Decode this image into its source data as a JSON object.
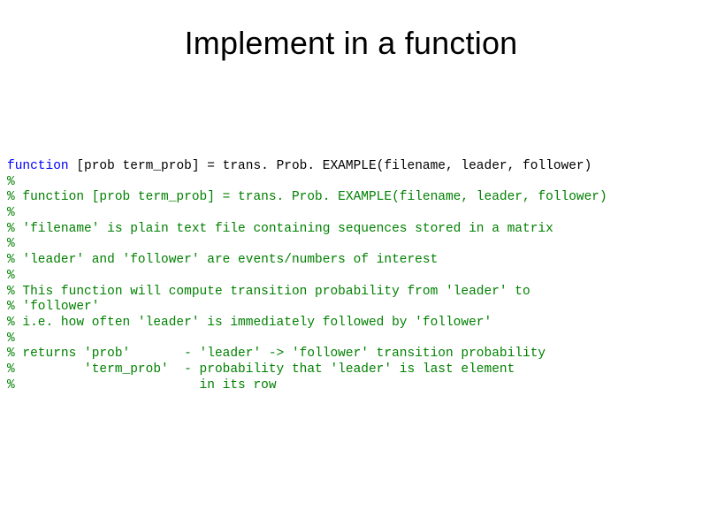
{
  "title": "Implement in a function",
  "code": {
    "kw1": "function ",
    "sig": "[prob term_prob] = trans. Prob. EXAMPLE(filename, leader, follower)",
    "c1": "%",
    "c2": "% function [prob term_prob] = trans. Prob. EXAMPLE(filename, leader, follower)",
    "c3": "%",
    "c4": "% 'filename' is plain text file containing sequences stored in a matrix",
    "c5": "%",
    "c6": "% 'leader' and 'follower' are events/numbers of interest",
    "c7": "%",
    "c8": "% This function will compute transition probability from 'leader' to",
    "c9": "% 'follower'",
    "c10": "% i.e. how often 'leader' is immediately followed by 'follower'",
    "c11": "%",
    "c12": "% returns 'prob'       - 'leader' -> 'follower' transition probability",
    "c13": "%         'term_prob'  - probability that 'leader' is last element",
    "c14": "%                        in its row"
  }
}
